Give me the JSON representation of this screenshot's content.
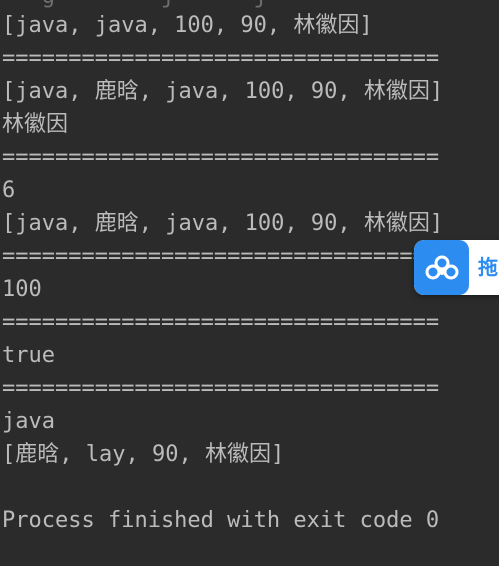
{
  "console": {
    "top_partial": "   g        j      j",
    "lines": [
      "[java, java, 100, 90, 林徽因]",
      "=================================",
      "[java, 鹿晗, java, 100, 90, 林徽因]",
      "林徽因",
      "=================================",
      "6",
      "[java, 鹿晗, java, 100, 90, 林徽因]",
      "=================================",
      "100",
      "=================================",
      "true",
      "=================================",
      "java",
      "[鹿晗, lay, 90, 林徽因]",
      "",
      "Process finished with exit code 0"
    ]
  },
  "float_widget": {
    "icon": "cloud-icon",
    "label": "拖"
  },
  "colors": {
    "background": "#2b2b2b",
    "text": "#bbbbbb",
    "accent": "#2d8cf0"
  }
}
